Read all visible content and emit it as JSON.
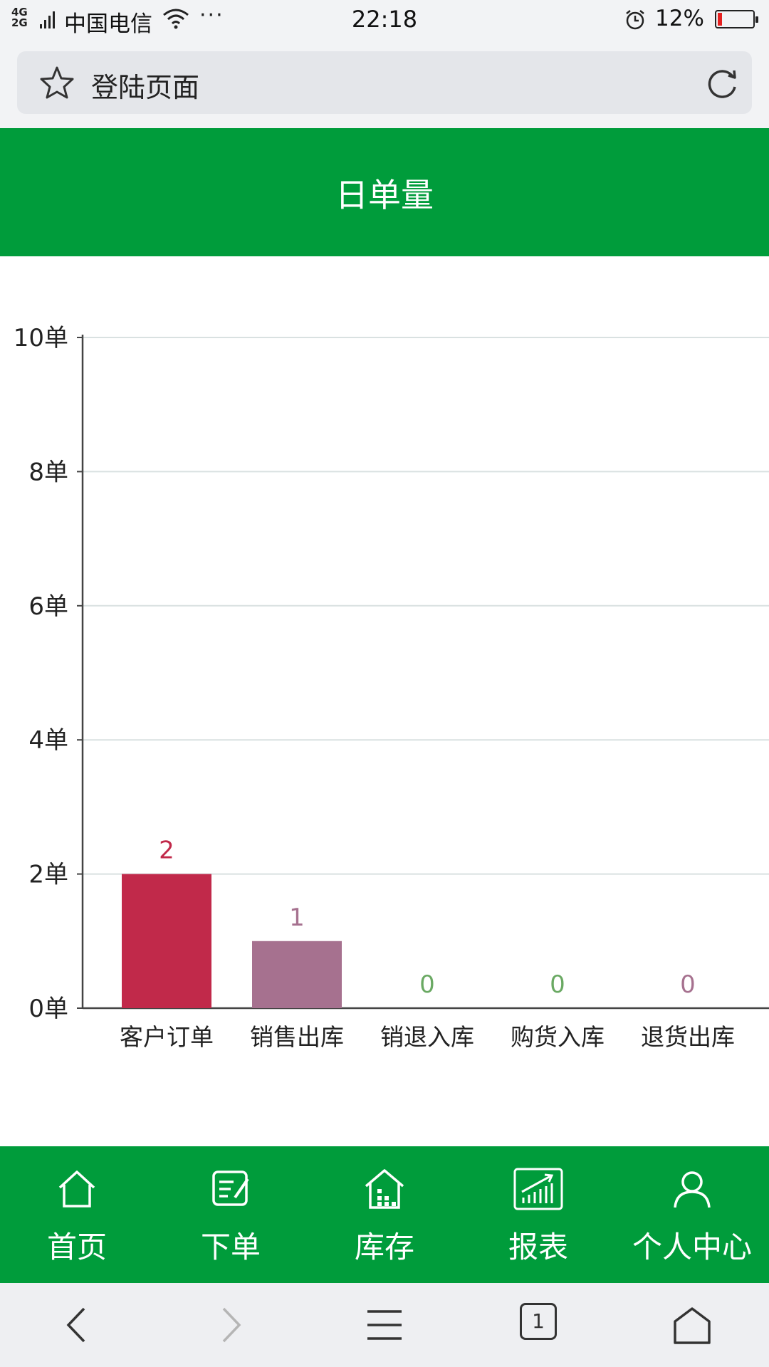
{
  "status_bar": {
    "network": "4G\n2G",
    "carrier": "中国电信",
    "dots": "···",
    "time": "22:18",
    "battery": "12%",
    "battery_level": 0.12
  },
  "address_bar": {
    "title": "登陆页面"
  },
  "header": {
    "title": "日单量"
  },
  "chart_data": {
    "type": "bar",
    "categories": [
      "客户订单",
      "销售出库",
      "销退入库",
      "购货入库",
      "退货出库"
    ],
    "values": [
      2,
      1,
      0,
      0,
      0
    ],
    "colors": [
      "#c1294a",
      "#a6718f",
      "#6aa963",
      "#6aa963",
      "#a6718f"
    ],
    "label_colors": [
      "#c1294a",
      "#a6718f",
      "#6aa963",
      "#6aa963",
      "#a6718f"
    ],
    "ylim": [
      0,
      10
    ],
    "yticks": [
      0,
      2,
      4,
      6,
      8,
      10
    ],
    "ytick_suffix": "单",
    "grid": true,
    "title": "",
    "xlabel": "",
    "ylabel": ""
  },
  "tab_bar": {
    "items": [
      {
        "label": "首页",
        "icon": "home-icon"
      },
      {
        "label": "下单",
        "icon": "edit-order-icon"
      },
      {
        "label": "库存",
        "icon": "warehouse-icon"
      },
      {
        "label": "报表",
        "icon": "report-chart-icon"
      },
      {
        "label": "个人中心",
        "icon": "user-icon"
      }
    ]
  },
  "browser_nav": {
    "tab_count": "1"
  }
}
